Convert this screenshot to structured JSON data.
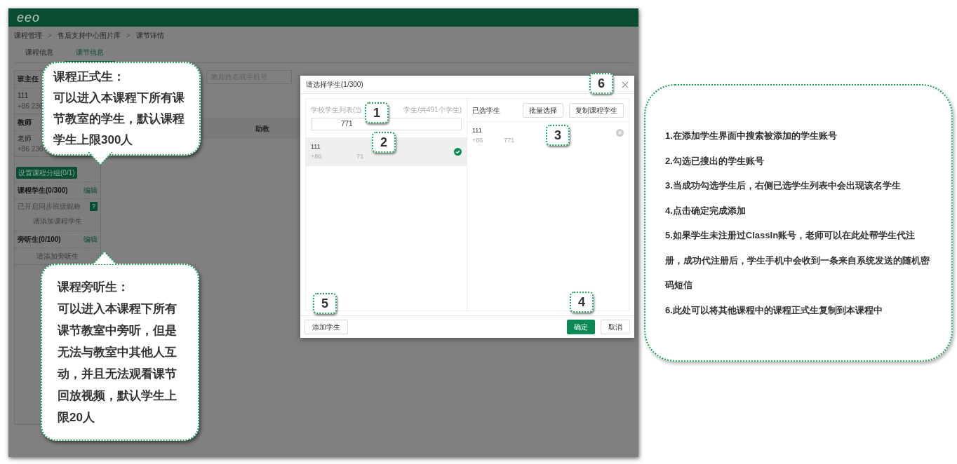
{
  "app": {
    "logo": "eeo",
    "breadcrumb": [
      "课程管理",
      "售后支持中心图片库",
      "课节详情"
    ],
    "breadcrumb_separator": ">",
    "tabs": [
      {
        "label": "课程信息",
        "selected": false
      },
      {
        "label": "课节信息",
        "selected": true
      }
    ],
    "sidebar": {
      "sections": [
        {
          "title": "班主任",
          "name": "111",
          "phone": "+86 236"
        },
        {
          "title": "教师",
          "name": "老师",
          "phone": "+86 236"
        }
      ],
      "group_button": "设置课程分组(0/1)",
      "students": {
        "title": "课程学生(0/300)",
        "edit": "编辑",
        "sync_note": "已开启同步班级昵称",
        "help": "?",
        "empty": "请添加课程学生"
      },
      "auditors": {
        "title": "旁听生(0/100)",
        "edit": "编辑",
        "empty": "请添加旁听生"
      }
    },
    "filters": {
      "teacher_placeholder": "教师姓名或手机号"
    },
    "table": {
      "columns": [
        "助教"
      ]
    }
  },
  "dialog": {
    "title": "请选择学生(1/300)",
    "list_hint": [
      "学校学生列表(当",
      "学生/共491个学生)"
    ],
    "search_value": "771",
    "students": [
      {
        "name": "111",
        "phone": "+86",
        "number": "71",
        "selected": true
      }
    ],
    "selected_title": "已选学生",
    "actions": [
      "批量选择",
      "复制课程学生"
    ],
    "selected_students": [
      {
        "name": "111",
        "phone": "+86",
        "number": "771"
      }
    ],
    "add_button": "添加学生",
    "confirm": "确定",
    "cancel": "取消"
  },
  "badges": [
    {
      "label": "1"
    },
    {
      "label": "2"
    },
    {
      "label": "3"
    },
    {
      "label": "4"
    },
    {
      "label": "5"
    },
    {
      "label": "6"
    }
  ],
  "callouts": [
    {
      "title": "课程正式生：",
      "body": "可以进入本课程下所有课节教室的学生，默认课程学生上限300人"
    },
    {
      "title": "课程旁听生：",
      "body": "可以进入本课程下所有课节教室中旁听，但是无法与教室中其他人互动，并且无法观看课节回放视频，默认学生上限20人"
    }
  ],
  "notes": [
    "1.在添加学生界面中搜索被添加的学生账号",
    "2.勾选已搜出的学生账号",
    "3.当成功勾选学生后，右侧已选学生列表中会出现该名学生",
    "4.点击确定完成添加",
    "5.如果学生未注册过ClassIn账号，老师可以在此处帮学生代注册，成功代注册后，学生手机中会收到一条来自系统发送的随机密码短信",
    "6.此处可以将其他课程中的课程正式生复制到本课程中"
  ]
}
